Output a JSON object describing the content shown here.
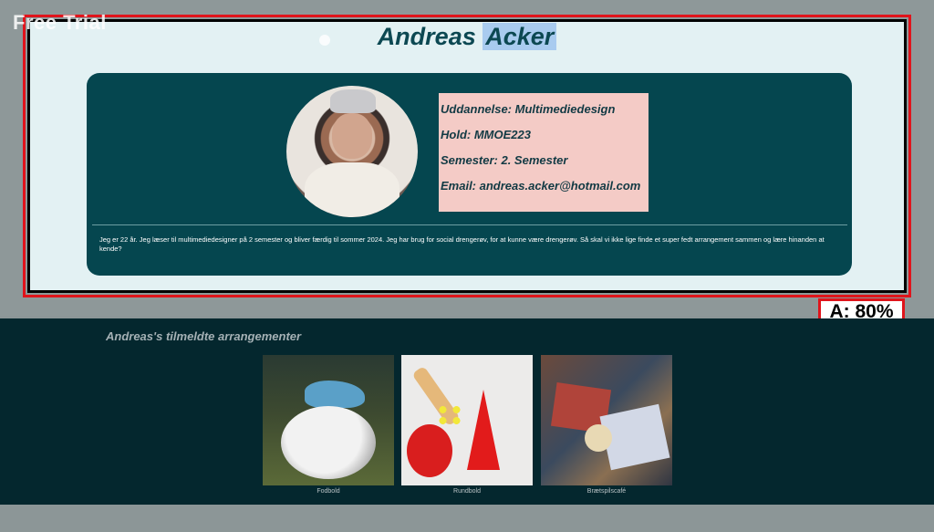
{
  "overlay": {
    "free_trial": "Free Trial",
    "badge": "A: 80%"
  },
  "profile": {
    "first_name": "Andreas",
    "last_name": "Acker",
    "education": "Uddannelse: Multimediedesign",
    "team": "Hold: MMOE223",
    "semester": "Semester: 2. Semester",
    "email": "Email: andreas.acker@hotmail.com",
    "bio": "Jeg er 22 år. Jeg læser til multimediedesigner på 2 semester og bliver færdig til sommer 2024. Jeg har brug for social drengerøv, for at kunne være drengerøv. Så skal vi ikke lige finde et super fedt arrangement sammen og lære hinanden at kende?"
  },
  "events": {
    "title": "Andreas's tilmeldte arrangementer",
    "items": [
      {
        "label": "Fodbold"
      },
      {
        "label": "Rundbold"
      },
      {
        "label": "Brætspilscafé"
      }
    ]
  },
  "colors": {
    "panel": "#05464f",
    "events_bg": "#04272e",
    "info_box": "#f4cbc6",
    "selection_frame": "#e0141b"
  }
}
